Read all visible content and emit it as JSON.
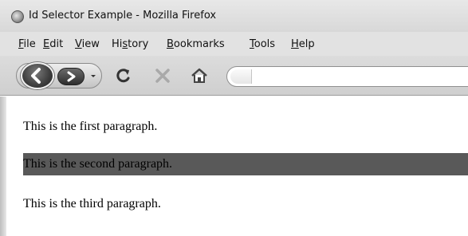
{
  "window": {
    "title": "Id Selector Example - Mozilla Firefox",
    "icon": "firefox-icon"
  },
  "menu": {
    "items": [
      {
        "label_u": "F",
        "label_rest": "ile"
      },
      {
        "label_u": "E",
        "label_rest": "dit"
      },
      {
        "label_u": "V",
        "label_rest": "iew"
      },
      {
        "label_pre": "Hi",
        "label_u": "s",
        "label_rest": "tory"
      },
      {
        "label_u": "B",
        "label_rest": "ookmarks"
      },
      {
        "label_u": "T",
        "label_rest": "ools"
      },
      {
        "label_u": "H",
        "label_rest": "elp"
      }
    ]
  },
  "toolbar": {
    "back_icon": "back-arrow-icon",
    "forward_icon": "forward-arrow-icon",
    "history_dropdown_icon": "chevron-down-icon",
    "reload_icon": "reload-icon",
    "stop_icon": "stop-icon",
    "home_icon": "home-icon",
    "url_value": ""
  },
  "page": {
    "paragraphs": [
      "This is the first paragraph.",
      "This is the second paragraph.",
      "This is the third paragraph."
    ],
    "highlight_color": "#595959"
  }
}
